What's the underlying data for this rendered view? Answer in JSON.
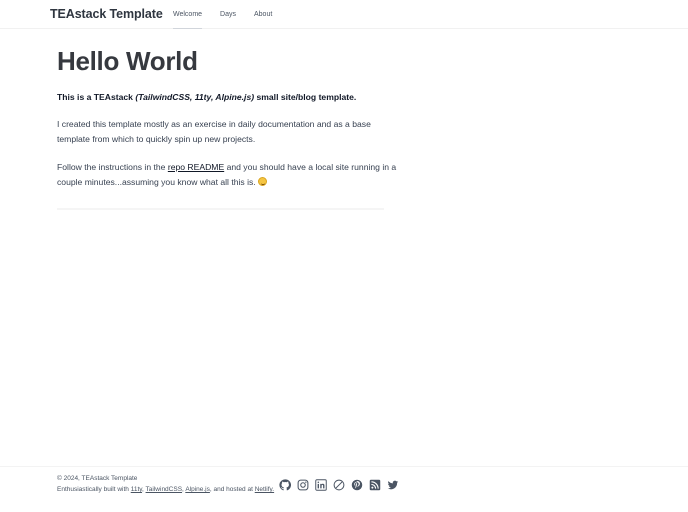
{
  "header": {
    "brand": "TEAstack Template",
    "nav": [
      {
        "label": "Welcome",
        "active": true
      },
      {
        "label": "Days",
        "active": false
      },
      {
        "label": "About",
        "active": false
      }
    ]
  },
  "main": {
    "title": "Hello World",
    "intro_prefix": "This is a TEAstack",
    "intro_italic": "(TailwindCSS, 11ty, Alpine.js)",
    "intro_suffix": "small site/blog template.",
    "para1": "I created this template mostly as an exercise in daily documentation and as a base template from which to quickly spin up new projects.",
    "para2_prefix": "Follow the instructions in the",
    "para2_link": "repo README",
    "para2_suffix": "and you should have a local site running in a couple minutes...assuming you know what all this is."
  },
  "footer": {
    "copyright": "© 2024, TEAstack Template",
    "built_prefix": "Enthusiastically built with",
    "links": [
      "11ty",
      "TailwindCSS",
      "Alpine.js"
    ],
    "hosted_text": ", and hosted at",
    "host_link": "Netlify.",
    "social_icons": [
      "github-icon",
      "instagram-icon",
      "linkedin-icon",
      "compass-icon",
      "pinterest-icon",
      "rss-icon",
      "twitter-icon"
    ],
    "icon_color": "#4b5563"
  },
  "colors": {
    "title": "#36393f",
    "text": "#374151",
    "link": "#111827"
  }
}
